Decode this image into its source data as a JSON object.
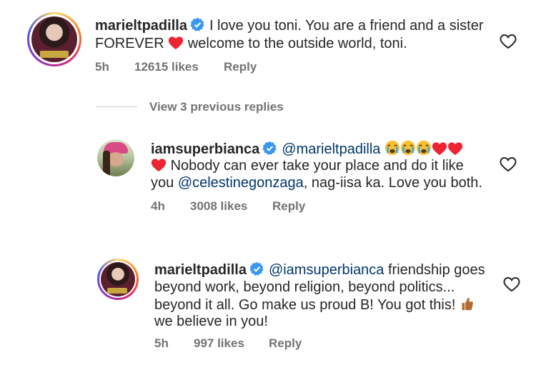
{
  "comments": [
    {
      "username": "marieltpadilla",
      "line1_text": "I love you toni. You are a friend and a sister",
      "line2_before_heart": "FOREVER",
      "line2_after_heart": "welcome to the outside world, toni.",
      "time": "5h",
      "likes": "12615 likes",
      "reply_label": "Reply"
    },
    {
      "username": "iamsuperbianca",
      "mention": "@marieltpadilla",
      "line2_text": "Nobody can ever take your place and do it like",
      "line3_before": "you",
      "line3_mention": "@celestinegonzaga",
      "line3_after": ", nag-iisa ka. Love you both.",
      "time": "4h",
      "likes": "3008 likes",
      "reply_label": "Reply"
    },
    {
      "username": "marieltpadilla",
      "mention": "@iamsuperbianca",
      "line1_after": "friendship goes",
      "line2_text": "beyond work, beyond religion, beyond politics...",
      "line3_text": "beyond it all. Go make us proud B! You got this!",
      "line4_text": "we believe in you!",
      "time": "5h",
      "likes": "997 likes",
      "reply_label": "Reply"
    }
  ],
  "view_replies": "View 3 previous replies",
  "colors": {
    "verified": "#3897f0",
    "heart": "#ed2533",
    "mention": "#00376b",
    "meta": "#737373"
  }
}
